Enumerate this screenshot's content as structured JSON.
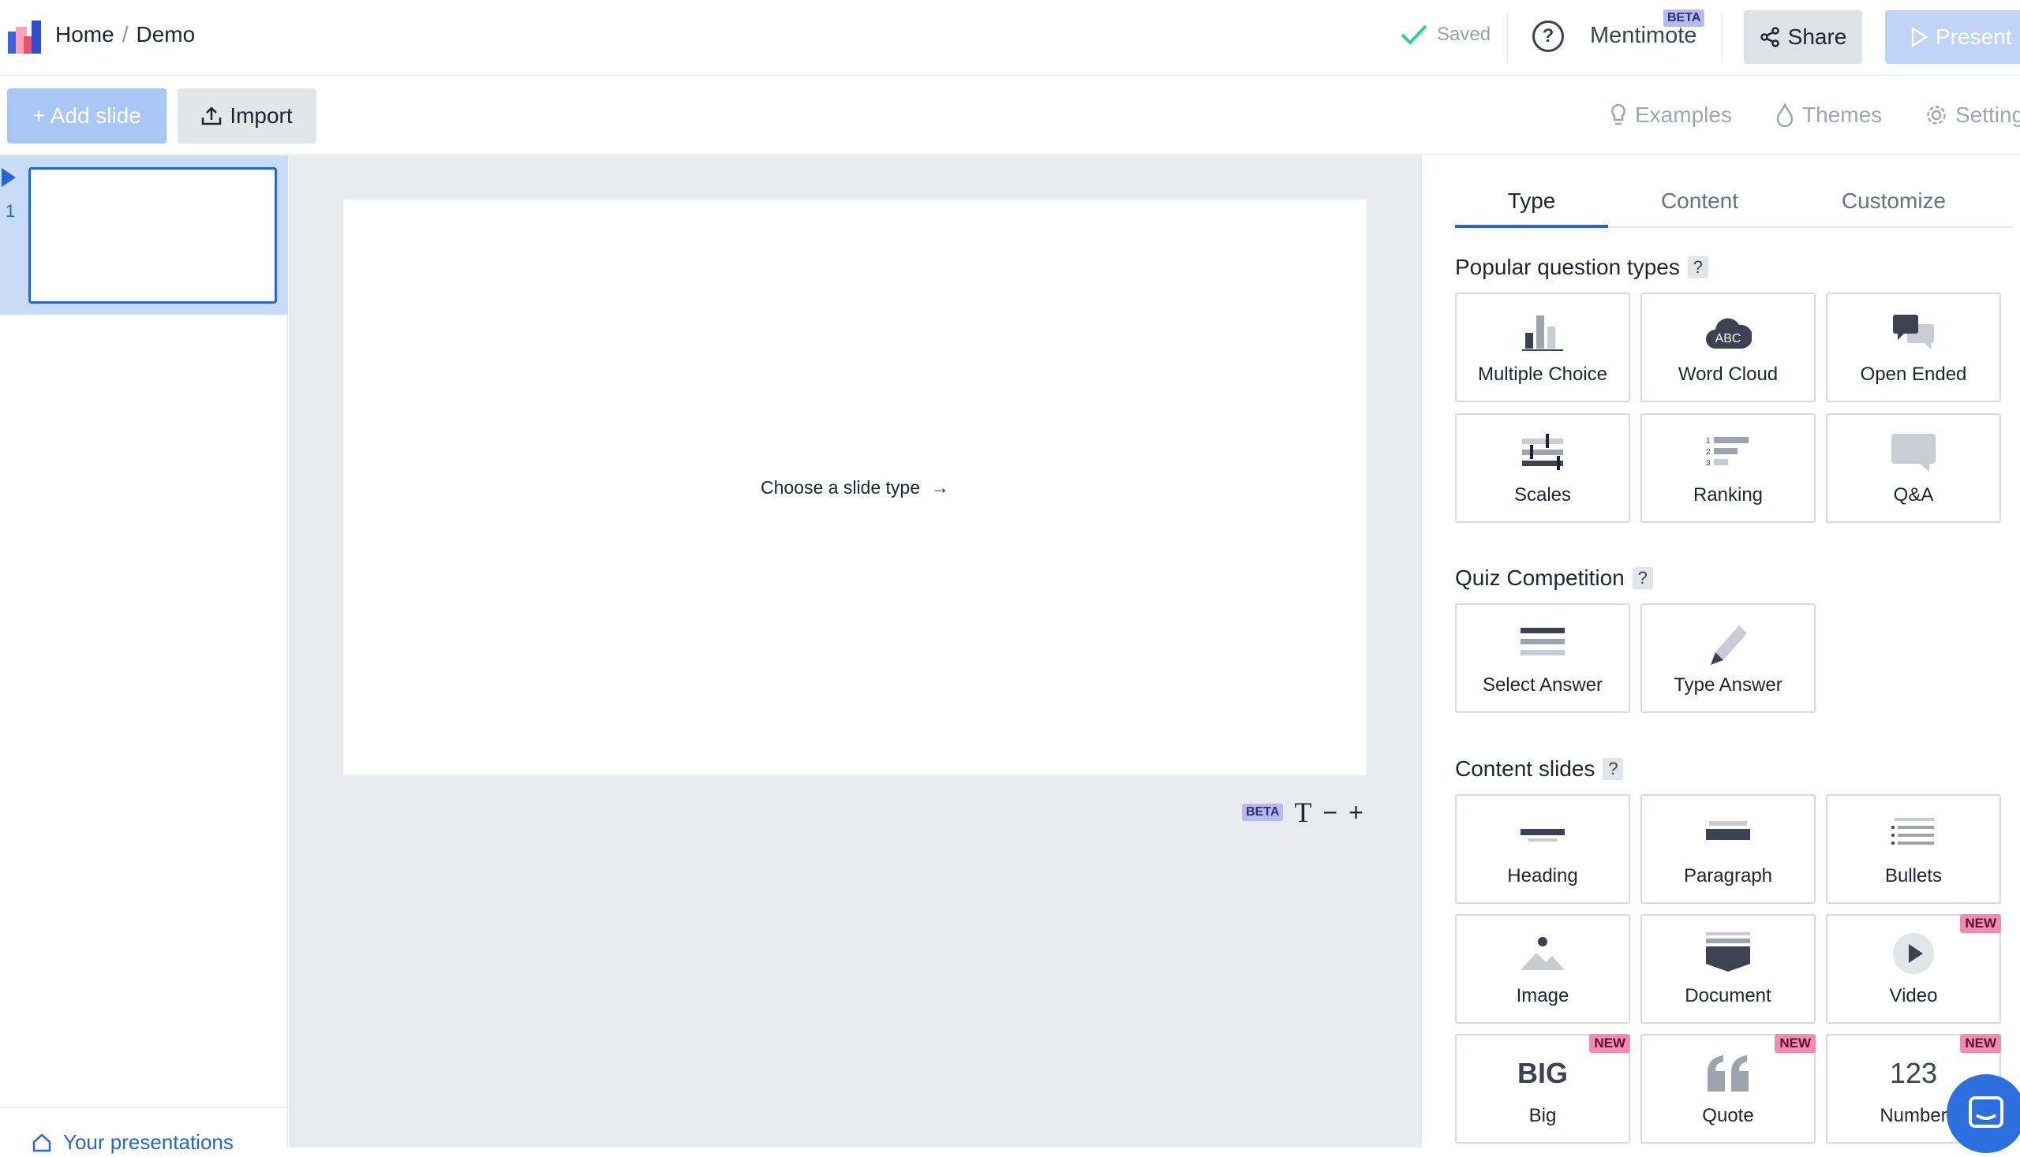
{
  "header": {
    "breadcrumb_home": "Home",
    "breadcrumb_sep": "/",
    "breadcrumb_current": "Demo",
    "saved_label": "Saved",
    "help_symbol": "?",
    "mentimote_label": "Mentimote",
    "mentimote_badge": "BETA",
    "share_label": "Share",
    "present_label": "Present"
  },
  "toolbar": {
    "add_slide_label": "+ Add slide",
    "import_label": "Import",
    "examples_label": "Examples",
    "themes_label": "Themes",
    "settings_label": "Settings"
  },
  "sidebar": {
    "slides": [
      {
        "number": "1"
      }
    ],
    "your_presentations_label": "Your presentations"
  },
  "canvas": {
    "placeholder": "Choose a slide type",
    "arrow": "→",
    "beta_badge": "BETA",
    "text_size_icon": "T",
    "zoom_out": "−",
    "zoom_in": "+"
  },
  "panel": {
    "tabs": [
      "Type",
      "Content",
      "Customize"
    ],
    "active_tab": "Type",
    "sections": {
      "popular_title": "Popular question types",
      "quiz_title": "Quiz Competition",
      "content_title": "Content slides"
    },
    "popular": [
      {
        "label": "Multiple Choice",
        "icon": "bar-chart-icon"
      },
      {
        "label": "Word Cloud",
        "icon": "word-cloud-icon"
      },
      {
        "label": "Open Ended",
        "icon": "speech-bubbles-icon"
      },
      {
        "label": "Scales",
        "icon": "scales-icon"
      },
      {
        "label": "Ranking",
        "icon": "ranking-icon"
      },
      {
        "label": "Q&A",
        "icon": "qa-bubble-icon"
      }
    ],
    "quiz": [
      {
        "label": "Select Answer",
        "icon": "list-lines-icon"
      },
      {
        "label": "Type Answer",
        "icon": "pencil-icon"
      }
    ],
    "content": [
      {
        "label": "Heading",
        "icon": "heading-icon",
        "badge": ""
      },
      {
        "label": "Paragraph",
        "icon": "paragraph-icon",
        "badge": ""
      },
      {
        "label": "Bullets",
        "icon": "bullets-icon",
        "badge": ""
      },
      {
        "label": "Image",
        "icon": "image-icon",
        "badge": ""
      },
      {
        "label": "Document",
        "icon": "document-icon",
        "badge": ""
      },
      {
        "label": "Video",
        "icon": "video-play-icon",
        "badge": "NEW"
      },
      {
        "label": "Big",
        "icon": "big-text-icon",
        "badge": "NEW",
        "glyph": "BIG"
      },
      {
        "label": "Quote",
        "icon": "quote-icon",
        "badge": "NEW"
      },
      {
        "label": "Number",
        "icon": "number-icon",
        "badge": "NEW",
        "glyph": "123"
      }
    ]
  },
  "colors": {
    "accent": "#2565d6",
    "present_bg": "#bfd4f7",
    "add_slide_bg": "#a9c7f5",
    "new_badge": "#f28bb0",
    "beta_badge": "#b7baf0",
    "saved_check": "#2ecf9a"
  }
}
